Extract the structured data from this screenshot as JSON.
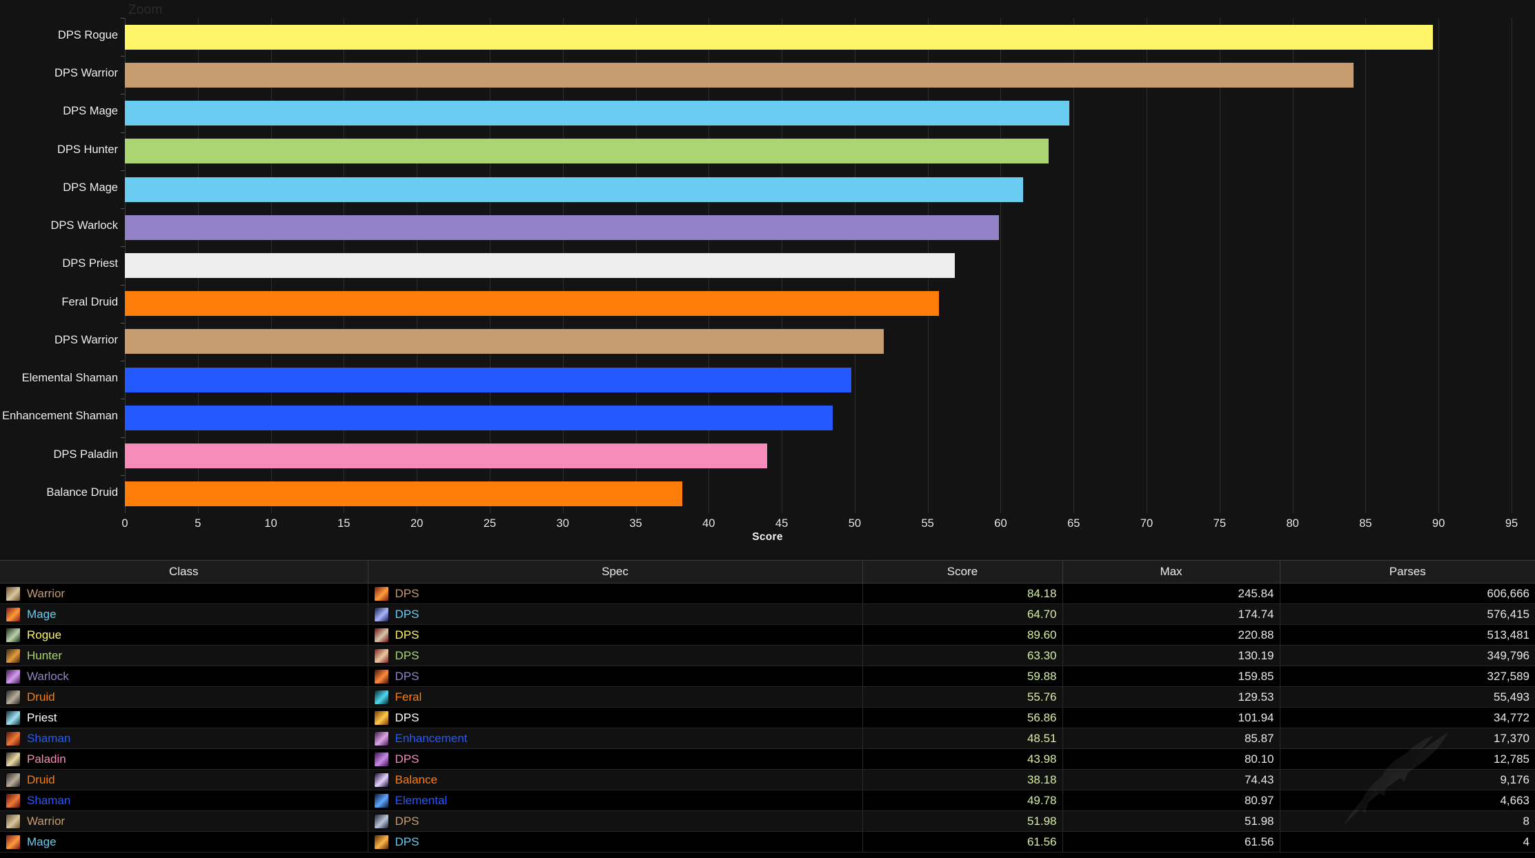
{
  "chart_data": {
    "type": "bar",
    "orientation": "horizontal",
    "title": "Zoom",
    "xlabel": "Score",
    "ylabel": "",
    "xlim": [
      0,
      95
    ],
    "xticks": [
      0,
      5,
      10,
      15,
      20,
      25,
      30,
      35,
      40,
      45,
      50,
      55,
      60,
      65,
      70,
      75,
      80,
      85,
      90,
      95
    ],
    "grid": true,
    "legend": "none",
    "categories": [
      "DPS Rogue",
      "DPS Warrior",
      "DPS Mage",
      "DPS Hunter",
      "DPS Mage",
      "DPS Warlock",
      "DPS Priest",
      "Feral Druid",
      "DPS Warrior",
      "Elemental Shaman",
      "Enhancement Shaman",
      "DPS Paladin",
      "Balance Druid"
    ],
    "values": [
      89.6,
      84.18,
      64.7,
      63.3,
      61.56,
      59.88,
      56.86,
      55.76,
      51.98,
      49.78,
      48.51,
      43.98,
      38.18
    ],
    "bar_colors": [
      "#fff569",
      "#c79c6e",
      "#69ccf0",
      "#abd473",
      "#69ccf0",
      "#9482c9",
      "#eeeeee",
      "#ff7d0a",
      "#c79c6e",
      "#2459ff",
      "#2459ff",
      "#f58cba",
      "#ff7d0a"
    ]
  },
  "table": {
    "columns": [
      "Class",
      "Spec",
      "Score",
      "Max",
      "Parses"
    ],
    "rows": [
      {
        "class": "Warrior",
        "class_color": "#c79c6e",
        "spec": "DPS",
        "spec_color": "#c79c6e",
        "score": "84.18",
        "max": "245.84",
        "parses": "606,666",
        "class_icon": "warrior-class-icon",
        "spec_icon": "warrior-dps-spec-icon",
        "icon_a": "#6b4f30",
        "icon_b": "#d8c7a0",
        "sicon_a": "#7a1d10",
        "sicon_b": "#ff9e3d"
      },
      {
        "class": "Mage",
        "class_color": "#69ccf0",
        "spec": "DPS",
        "spec_color": "#69ccf0",
        "score": "64.70",
        "max": "174.74",
        "parses": "576,415",
        "class_icon": "mage-class-icon",
        "spec_icon": "mage-dps-spec-icon",
        "icon_a": "#7d1a1a",
        "icon_b": "#ff9a3c",
        "sicon_a": "#161a4a",
        "sicon_b": "#a8b6ff"
      },
      {
        "class": "Rogue",
        "class_color": "#fff569",
        "spec": "DPS",
        "spec_color": "#fff569",
        "score": "89.60",
        "max": "220.88",
        "parses": "513,481",
        "class_icon": "rogue-class-icon",
        "spec_icon": "rogue-dps-spec-icon",
        "icon_a": "#1d2c1c",
        "icon_b": "#b9d2a8",
        "sicon_a": "#6e1218",
        "sicon_b": "#d8c3a8"
      },
      {
        "class": "Hunter",
        "class_color": "#abd473",
        "spec": "DPS",
        "spec_color": "#abd473",
        "score": "63.30",
        "max": "130.19",
        "parses": "349,796",
        "class_icon": "hunter-class-icon",
        "spec_icon": "hunter-dps-spec-icon",
        "icon_a": "#3a2510",
        "icon_b": "#e39b3c",
        "sicon_a": "#7e2020",
        "sicon_b": "#e9c8a0"
      },
      {
        "class": "Warlock",
        "class_color": "#9482c9",
        "spec": "DPS",
        "spec_color": "#9482c9",
        "score": "59.88",
        "max": "159.85",
        "parses": "327,589",
        "class_icon": "warlock-class-icon",
        "spec_icon": "warlock-dps-spec-icon",
        "icon_a": "#3a1b4a",
        "icon_b": "#d79bf0",
        "sicon_a": "#4a1208",
        "sicon_b": "#ff8a3c"
      },
      {
        "class": "Druid",
        "class_color": "#ff7d0a",
        "spec": "Feral",
        "spec_color": "#ff7d0a",
        "score": "55.76",
        "max": "129.53",
        "parses": "55,493",
        "class_icon": "druid-class-icon",
        "spec_icon": "druid-feral-spec-icon",
        "icon_a": "#2a2420",
        "icon_b": "#b8ad9d",
        "sicon_a": "#04252e",
        "sicon_b": "#4fd8ef"
      },
      {
        "class": "Priest",
        "class_color": "#ffffff",
        "spec": "DPS",
        "spec_color": "#ffffff",
        "score": "56.86",
        "max": "101.94",
        "parses": "34,772",
        "class_icon": "priest-class-icon",
        "spec_icon": "priest-dps-spec-icon",
        "icon_a": "#10313a",
        "icon_b": "#9fe3f2",
        "sicon_a": "#7a3a05",
        "sicon_b": "#ffc84a"
      },
      {
        "class": "Shaman",
        "class_color": "#2459ff",
        "spec": "Enhancement",
        "spec_color": "#2459ff",
        "score": "48.51",
        "max": "85.87",
        "parses": "17,370",
        "class_icon": "shaman-class-icon",
        "spec_icon": "shaman-enhancement-spec-icon",
        "icon_a": "#5b1208",
        "icon_b": "#ef7a3a",
        "sicon_a": "#3d1a4a",
        "sicon_b": "#e0a4e8"
      },
      {
        "class": "Paladin",
        "class_color": "#f58cba",
        "spec": "DPS",
        "spec_color": "#f58cba",
        "score": "43.98",
        "max": "80.10",
        "parses": "12,785",
        "class_icon": "paladin-class-icon",
        "spec_icon": "paladin-dps-spec-icon",
        "icon_a": "#3a3020",
        "icon_b": "#e9dca8",
        "sicon_a": "#3d1050",
        "sicon_b": "#c98ae8"
      },
      {
        "class": "Druid",
        "class_color": "#ff7d0a",
        "spec": "Balance",
        "spec_color": "#ff7d0a",
        "score": "38.18",
        "max": "74.43",
        "parses": "9,176",
        "class_icon": "druid-class-icon",
        "spec_icon": "druid-balance-spec-icon",
        "icon_a": "#2a2420",
        "icon_b": "#b8ad9d",
        "sicon_a": "#1d0b30",
        "sicon_b": "#e6d2ff"
      },
      {
        "class": "Shaman",
        "class_color": "#2459ff",
        "spec": "Elemental",
        "spec_color": "#2459ff",
        "score": "49.78",
        "max": "80.97",
        "parses": "4,663",
        "class_icon": "shaman-class-icon",
        "spec_icon": "shaman-elemental-spec-icon",
        "icon_a": "#5b1208",
        "icon_b": "#ef7a3a",
        "sicon_a": "#061535",
        "sicon_b": "#5fa8ff"
      },
      {
        "class": "Warrior",
        "class_color": "#c79c6e",
        "spec": "DPS",
        "spec_color": "#c79c6e",
        "score": "51.98",
        "max": "51.98",
        "parses": "8",
        "class_icon": "warrior-class-icon",
        "spec_icon": "warrior-dps-spec-icon",
        "icon_a": "#6b4f30",
        "icon_b": "#d8c7a0",
        "sicon_a": "#1e2430",
        "sicon_b": "#b9c6dd"
      },
      {
        "class": "Mage",
        "class_color": "#69ccf0",
        "spec": "DPS",
        "spec_color": "#69ccf0",
        "score": "61.56",
        "max": "61.56",
        "parses": "4",
        "class_icon": "mage-class-icon",
        "spec_icon": "mage-dps-spec-icon",
        "icon_a": "#7d1a1a",
        "icon_b": "#ff9a3c",
        "sicon_a": "#5a2a05",
        "sicon_b": "#ffb44a"
      }
    ]
  }
}
